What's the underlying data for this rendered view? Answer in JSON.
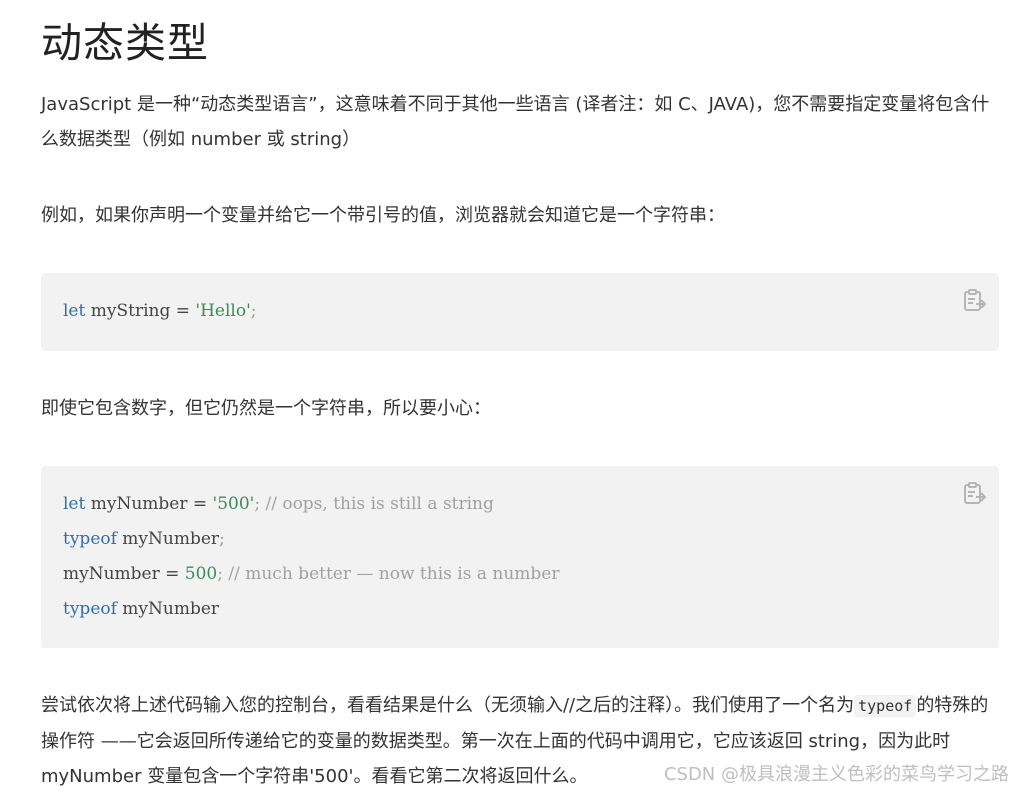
{
  "page_title": "动态类型",
  "paragraph_1": "JavaScript 是一种“动态类型语言”，这意味着不同于其他一些语言 (译者注：如 C、JAVA)，您不需要指定变量将包含什么数据类型（例如 number 或 string）",
  "paragraph_2": "例如，如果你声明一个变量并给它一个带引号的值，浏览器就会知道它是一个字符串：",
  "code_block_1": {
    "lines": [
      [
        {
          "t": "let",
          "c": "kw"
        },
        {
          "t": " myString = ",
          "c": ""
        },
        {
          "t": "'Hello'",
          "c": "str"
        },
        {
          "t": ";",
          "c": "punc"
        }
      ]
    ]
  },
  "paragraph_3": "即使它包含数字，但它仍然是一个字符串，所以要小心：",
  "code_block_2": {
    "lines": [
      [
        {
          "t": "let",
          "c": "kw"
        },
        {
          "t": " myNumber = ",
          "c": ""
        },
        {
          "t": "'500'",
          "c": "str"
        },
        {
          "t": "; // oops, this is still a string",
          "c": "cmt"
        }
      ],
      [
        {
          "t": "typeof",
          "c": "kw"
        },
        {
          "t": " myNumber",
          "c": ""
        },
        {
          "t": ";",
          "c": "punc"
        }
      ],
      [
        {
          "t": "myNumber = ",
          "c": ""
        },
        {
          "t": "500",
          "c": "num"
        },
        {
          "t": "; // much better — now this is a number",
          "c": "cmt"
        }
      ],
      [
        {
          "t": "typeof",
          "c": "kw"
        },
        {
          "t": " myNumber",
          "c": ""
        }
      ]
    ]
  },
  "paragraph_4": {
    "before": "尝试依次将上述代码输入您的控制台，看看结果是什么（无须输入//之后的注释）。我们使用了一个名为",
    "code": "typeof",
    "after": "的特殊的操作符 ——它会返回所传递给它的变量的数据类型。第一次在上面的代码中调用它，它应该返回 string，因为此时 myNumber 变量包含一个字符串'500'。看看它第二次将返回什么。"
  },
  "copy_icon": "clipboard-copy-icon",
  "watermark": "CSDN @极具浪漫主义色彩的菜鸟学习之路",
  "colors": {
    "keyword": "#2e6fa8",
    "string": "#3a8a5c",
    "comment": "#a0a0a0",
    "code_bg": "#f2f2f2"
  }
}
